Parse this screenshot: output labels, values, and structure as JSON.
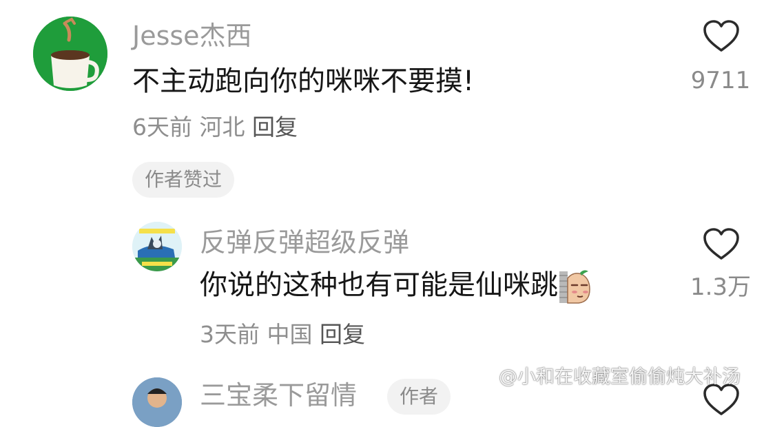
{
  "comments": [
    {
      "username": "Jesse杰西",
      "text": "不主动跑向你的咪咪不要摸!",
      "time": "6天前",
      "location": "河北",
      "reply_label": "回复",
      "badge": "作者赞过",
      "like_count": "9711",
      "avatar_icon": "coffee-mug-avatar"
    },
    {
      "username": "反弹反弹超级反弹",
      "text": "你说的这种也有可能是仙咪跳",
      "sticker_icon": "peeking-potato-sticker",
      "time": "3天前",
      "location": "中国",
      "reply_label": "回复",
      "like_count": "1.3万",
      "avatar_icon": "cartoon-cat-avatar"
    },
    {
      "username": "三宝柔下留情",
      "badge": "作者",
      "avatar_icon": "person-photo-avatar"
    }
  ],
  "watermark": {
    "text": "@小和在收藏室偷偷炖大补汤",
    "icon": "weibo-icon"
  },
  "colors": {
    "username": "#9a9a9a",
    "text": "#161616",
    "meta": "#8e8e8e",
    "badge_bg": "#f2f2f2"
  }
}
